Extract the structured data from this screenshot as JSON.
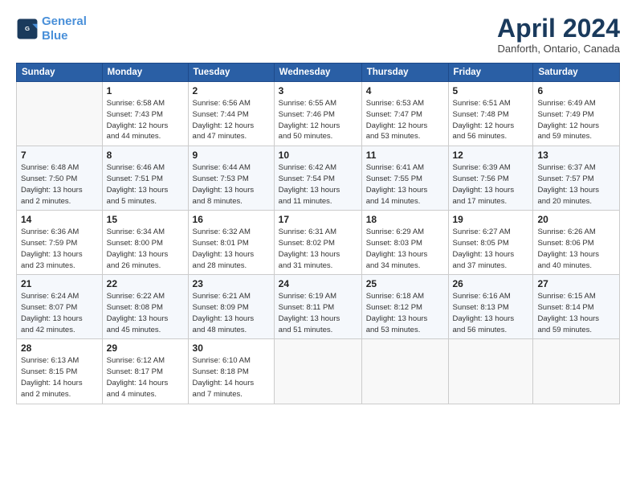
{
  "header": {
    "logo_line1": "General",
    "logo_line2": "Blue",
    "title": "April 2024",
    "location": "Danforth, Ontario, Canada"
  },
  "weekdays": [
    "Sunday",
    "Monday",
    "Tuesday",
    "Wednesday",
    "Thursday",
    "Friday",
    "Saturday"
  ],
  "weeks": [
    [
      {
        "day": "",
        "info": ""
      },
      {
        "day": "1",
        "info": "Sunrise: 6:58 AM\nSunset: 7:43 PM\nDaylight: 12 hours\nand 44 minutes."
      },
      {
        "day": "2",
        "info": "Sunrise: 6:56 AM\nSunset: 7:44 PM\nDaylight: 12 hours\nand 47 minutes."
      },
      {
        "day": "3",
        "info": "Sunrise: 6:55 AM\nSunset: 7:46 PM\nDaylight: 12 hours\nand 50 minutes."
      },
      {
        "day": "4",
        "info": "Sunrise: 6:53 AM\nSunset: 7:47 PM\nDaylight: 12 hours\nand 53 minutes."
      },
      {
        "day": "5",
        "info": "Sunrise: 6:51 AM\nSunset: 7:48 PM\nDaylight: 12 hours\nand 56 minutes."
      },
      {
        "day": "6",
        "info": "Sunrise: 6:49 AM\nSunset: 7:49 PM\nDaylight: 12 hours\nand 59 minutes."
      }
    ],
    [
      {
        "day": "7",
        "info": "Sunrise: 6:48 AM\nSunset: 7:50 PM\nDaylight: 13 hours\nand 2 minutes."
      },
      {
        "day": "8",
        "info": "Sunrise: 6:46 AM\nSunset: 7:51 PM\nDaylight: 13 hours\nand 5 minutes."
      },
      {
        "day": "9",
        "info": "Sunrise: 6:44 AM\nSunset: 7:53 PM\nDaylight: 13 hours\nand 8 minutes."
      },
      {
        "day": "10",
        "info": "Sunrise: 6:42 AM\nSunset: 7:54 PM\nDaylight: 13 hours\nand 11 minutes."
      },
      {
        "day": "11",
        "info": "Sunrise: 6:41 AM\nSunset: 7:55 PM\nDaylight: 13 hours\nand 14 minutes."
      },
      {
        "day": "12",
        "info": "Sunrise: 6:39 AM\nSunset: 7:56 PM\nDaylight: 13 hours\nand 17 minutes."
      },
      {
        "day": "13",
        "info": "Sunrise: 6:37 AM\nSunset: 7:57 PM\nDaylight: 13 hours\nand 20 minutes."
      }
    ],
    [
      {
        "day": "14",
        "info": "Sunrise: 6:36 AM\nSunset: 7:59 PM\nDaylight: 13 hours\nand 23 minutes."
      },
      {
        "day": "15",
        "info": "Sunrise: 6:34 AM\nSunset: 8:00 PM\nDaylight: 13 hours\nand 26 minutes."
      },
      {
        "day": "16",
        "info": "Sunrise: 6:32 AM\nSunset: 8:01 PM\nDaylight: 13 hours\nand 28 minutes."
      },
      {
        "day": "17",
        "info": "Sunrise: 6:31 AM\nSunset: 8:02 PM\nDaylight: 13 hours\nand 31 minutes."
      },
      {
        "day": "18",
        "info": "Sunrise: 6:29 AM\nSunset: 8:03 PM\nDaylight: 13 hours\nand 34 minutes."
      },
      {
        "day": "19",
        "info": "Sunrise: 6:27 AM\nSunset: 8:05 PM\nDaylight: 13 hours\nand 37 minutes."
      },
      {
        "day": "20",
        "info": "Sunrise: 6:26 AM\nSunset: 8:06 PM\nDaylight: 13 hours\nand 40 minutes."
      }
    ],
    [
      {
        "day": "21",
        "info": "Sunrise: 6:24 AM\nSunset: 8:07 PM\nDaylight: 13 hours\nand 42 minutes."
      },
      {
        "day": "22",
        "info": "Sunrise: 6:22 AM\nSunset: 8:08 PM\nDaylight: 13 hours\nand 45 minutes."
      },
      {
        "day": "23",
        "info": "Sunrise: 6:21 AM\nSunset: 8:09 PM\nDaylight: 13 hours\nand 48 minutes."
      },
      {
        "day": "24",
        "info": "Sunrise: 6:19 AM\nSunset: 8:11 PM\nDaylight: 13 hours\nand 51 minutes."
      },
      {
        "day": "25",
        "info": "Sunrise: 6:18 AM\nSunset: 8:12 PM\nDaylight: 13 hours\nand 53 minutes."
      },
      {
        "day": "26",
        "info": "Sunrise: 6:16 AM\nSunset: 8:13 PM\nDaylight: 13 hours\nand 56 minutes."
      },
      {
        "day": "27",
        "info": "Sunrise: 6:15 AM\nSunset: 8:14 PM\nDaylight: 13 hours\nand 59 minutes."
      }
    ],
    [
      {
        "day": "28",
        "info": "Sunrise: 6:13 AM\nSunset: 8:15 PM\nDaylight: 14 hours\nand 2 minutes."
      },
      {
        "day": "29",
        "info": "Sunrise: 6:12 AM\nSunset: 8:17 PM\nDaylight: 14 hours\nand 4 minutes."
      },
      {
        "day": "30",
        "info": "Sunrise: 6:10 AM\nSunset: 8:18 PM\nDaylight: 14 hours\nand 7 minutes."
      },
      {
        "day": "",
        "info": ""
      },
      {
        "day": "",
        "info": ""
      },
      {
        "day": "",
        "info": ""
      },
      {
        "day": "",
        "info": ""
      }
    ]
  ]
}
